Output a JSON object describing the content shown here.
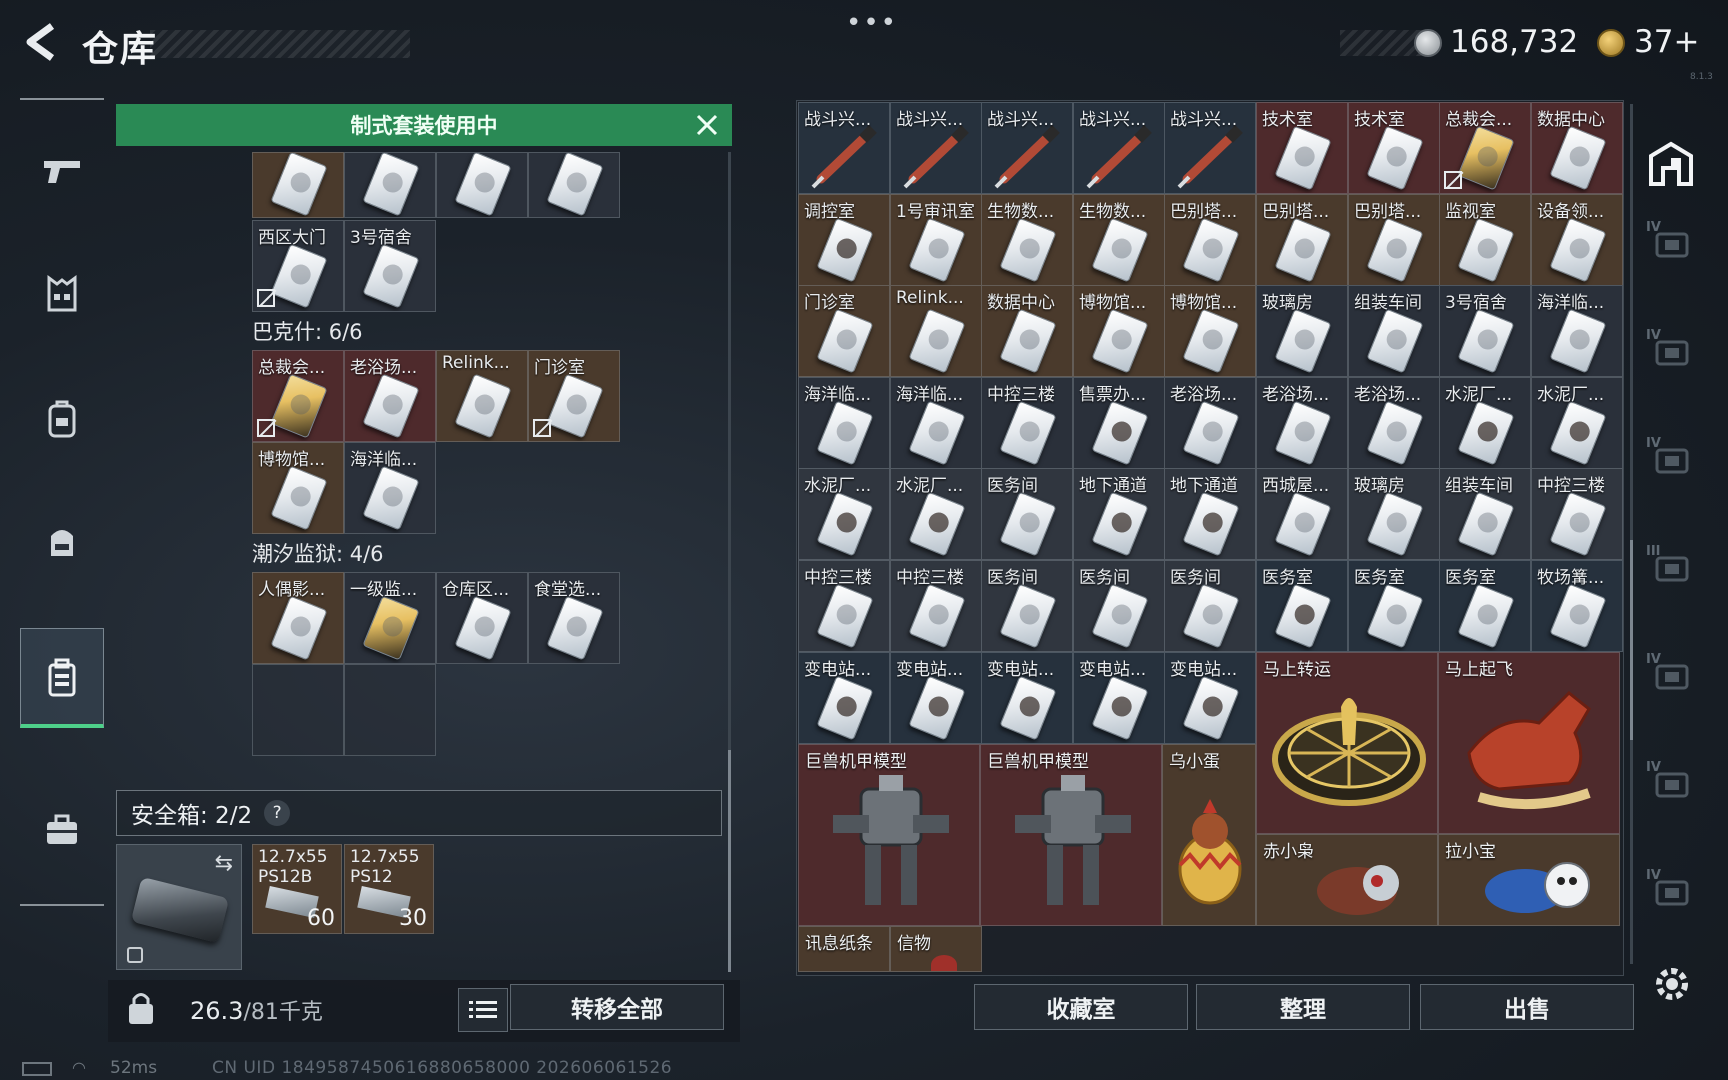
{
  "header": {
    "title": "仓库",
    "dots": "•••",
    "currency_silver": "168,732",
    "currency_gold": "37+",
    "corner_small": "8.1.3"
  },
  "left_nav": {
    "items": [
      "weapons",
      "armor",
      "backpack",
      "rig",
      "keycard-case",
      "briefcase"
    ],
    "active": "keycard-case"
  },
  "kit_banner": {
    "label": "制式套装使用中"
  },
  "left_panel": {
    "top_row_1": [
      {
        "label": "",
        "bg": "bg-brown",
        "card": "white"
      },
      {
        "label": "",
        "bg": "bg-dark",
        "card": "white"
      },
      {
        "label": "",
        "bg": "bg-dark",
        "card": "white"
      },
      {
        "label": "",
        "bg": "bg-dark",
        "card": "white"
      }
    ],
    "top_row_2": [
      {
        "label": "西区大门",
        "bg": "bg-dark",
        "card": "white",
        "locked": true
      },
      {
        "label": "3号宿舍",
        "bg": "bg-dark",
        "card": "white"
      }
    ],
    "section1_title": "巴克什: 6/6",
    "section1_row1": [
      {
        "label": "总裁会...",
        "bg": "bg-red",
        "card": "gold",
        "locked": true
      },
      {
        "label": "老浴场...",
        "bg": "bg-red",
        "card": "white"
      },
      {
        "label": "Relink...",
        "bg": "bg-brown",
        "card": "white"
      },
      {
        "label": "门诊室",
        "bg": "bg-brown",
        "card": "white",
        "locked": true
      }
    ],
    "section1_row2": [
      {
        "label": "博物馆...",
        "bg": "bg-brown",
        "card": "white"
      },
      {
        "label": "海洋临...",
        "bg": "bg-dark",
        "card": "white"
      }
    ],
    "section2_title": "潮汐监狱: 4/6",
    "section2_row1": [
      {
        "label": "人偶影...",
        "bg": "bg-brown",
        "card": "white"
      },
      {
        "label": "一级监...",
        "bg": "bg-dark",
        "card": "gold"
      },
      {
        "label": "仓库区...",
        "bg": "bg-dark",
        "card": "white"
      },
      {
        "label": "食堂选...",
        "bg": "bg-dark",
        "card": "white"
      }
    ]
  },
  "safe_box": {
    "label": "安全箱: 2/2",
    "help": "?",
    "swap_icon": "⇆",
    "ammo": [
      {
        "label": "12.7x55 PS12B",
        "qty": "60"
      },
      {
        "label": "12.7x55 PS12",
        "qty": "30"
      }
    ]
  },
  "footer_left": {
    "weight": "26.3",
    "weight_max": "/81千克",
    "transfer_all": "转移全部"
  },
  "grid": {
    "rows": [
      [
        {
          "label": "战斗兴...",
          "bg": "bg-blue",
          "item": "stim"
        },
        {
          "label": "战斗兴...",
          "bg": "bg-blue",
          "item": "stim"
        },
        {
          "label": "战斗兴...",
          "bg": "bg-blue",
          "item": "stim"
        },
        {
          "label": "战斗兴...",
          "bg": "bg-blue",
          "item": "stim"
        },
        {
          "label": "战斗兴...",
          "bg": "bg-blue",
          "item": "stim"
        },
        {
          "label": "技术室",
          "bg": "bg-red",
          "item": "card"
        },
        {
          "label": "技术室",
          "bg": "bg-red",
          "item": "card"
        },
        {
          "label": "总裁会...",
          "bg": "bg-red",
          "item": "card-gold",
          "locked": true
        },
        {
          "label": "数据中心",
          "bg": "bg-red",
          "item": "card"
        }
      ],
      [
        {
          "label": "调控室",
          "bg": "bg-brown",
          "item": "card-dark"
        },
        {
          "label": "1号审讯室",
          "bg": "bg-brown",
          "item": "card"
        },
        {
          "label": "生物数...",
          "bg": "bg-brown",
          "item": "card"
        },
        {
          "label": "生物数...",
          "bg": "bg-brown",
          "item": "card"
        },
        {
          "label": "巴别塔...",
          "bg": "bg-brown",
          "item": "card"
        },
        {
          "label": "巴别塔...",
          "bg": "bg-brown",
          "item": "card"
        },
        {
          "label": "巴别塔...",
          "bg": "bg-brown",
          "item": "card"
        },
        {
          "label": "监视室",
          "bg": "bg-brown",
          "item": "card"
        },
        {
          "label": "设备领...",
          "bg": "bg-brown",
          "item": "card"
        }
      ],
      [
        {
          "label": "门诊室",
          "bg": "bg-brown",
          "item": "card"
        },
        {
          "label": "Relink...",
          "bg": "bg-brown",
          "item": "card"
        },
        {
          "label": "数据中心",
          "bg": "bg-brown",
          "item": "card"
        },
        {
          "label": "博物馆...",
          "bg": "bg-brown",
          "item": "card"
        },
        {
          "label": "博物馆...",
          "bg": "bg-brown",
          "item": "card"
        },
        {
          "label": "玻璃房",
          "bg": "bg-dark",
          "item": "card"
        },
        {
          "label": "组装车间",
          "bg": "bg-dark",
          "item": "card"
        },
        {
          "label": "3号宿舍",
          "bg": "bg-dark",
          "item": "card"
        },
        {
          "label": "海洋临...",
          "bg": "bg-dark",
          "item": "card"
        }
      ],
      [
        {
          "label": "海洋临...",
          "bg": "bg-dark",
          "item": "card"
        },
        {
          "label": "海洋临...",
          "bg": "bg-dark",
          "item": "card"
        },
        {
          "label": "中控三楼",
          "bg": "bg-dark",
          "item": "card"
        },
        {
          "label": "售票办...",
          "bg": "bg-dark",
          "item": "card-dark"
        },
        {
          "label": "老浴场...",
          "bg": "bg-dark",
          "item": "card"
        },
        {
          "label": "老浴场...",
          "bg": "bg-dark",
          "item": "card"
        },
        {
          "label": "老浴场...",
          "bg": "bg-dark",
          "item": "card"
        },
        {
          "label": "水泥厂...",
          "bg": "bg-dark",
          "item": "card-dark"
        },
        {
          "label": "水泥厂...",
          "bg": "bg-dark",
          "item": "card-dark"
        }
      ],
      [
        {
          "label": "水泥厂...",
          "bg": "bg-slate",
          "item": "card-dark"
        },
        {
          "label": "水泥厂...",
          "bg": "bg-slate",
          "item": "card-dark"
        },
        {
          "label": "医务间",
          "bg": "bg-slate",
          "item": "card"
        },
        {
          "label": "地下通道",
          "bg": "bg-slate",
          "item": "card-dark"
        },
        {
          "label": "地下通道",
          "bg": "bg-slate",
          "item": "card-dark"
        },
        {
          "label": "西城屋...",
          "bg": "bg-slate",
          "item": "card"
        },
        {
          "label": "玻璃房",
          "bg": "bg-slate",
          "item": "card"
        },
        {
          "label": "组装车间",
          "bg": "bg-slate",
          "item": "card"
        },
        {
          "label": "中控三楼",
          "bg": "bg-slate",
          "item": "card"
        }
      ],
      [
        {
          "label": "中控三楼",
          "bg": "bg-slate",
          "item": "card"
        },
        {
          "label": "中控三楼",
          "bg": "bg-slate",
          "item": "card"
        },
        {
          "label": "医务间",
          "bg": "bg-slate",
          "item": "card"
        },
        {
          "label": "医务间",
          "bg": "bg-slate",
          "item": "card"
        },
        {
          "label": "医务间",
          "bg": "bg-slate",
          "item": "card"
        },
        {
          "label": "医务室",
          "bg": "bg-blue",
          "item": "card-dark"
        },
        {
          "label": "医务室",
          "bg": "bg-blue",
          "item": "card"
        },
        {
          "label": "医务室",
          "bg": "bg-blue",
          "item": "card"
        },
        {
          "label": "牧场篝...",
          "bg": "bg-blue",
          "item": "card"
        }
      ],
      [
        {
          "label": "变电站...",
          "bg": "bg-blue",
          "item": "card-dark"
        },
        {
          "label": "变电站...",
          "bg": "bg-blue",
          "item": "card-dark"
        },
        {
          "label": "变电站...",
          "bg": "bg-blue",
          "item": "card-dark"
        },
        {
          "label": "变电站...",
          "bg": "bg-blue",
          "item": "card-dark"
        },
        {
          "label": "变电站...",
          "bg": "bg-blue",
          "item": "card-dark"
        }
      ]
    ],
    "big_items": {
      "horse_wheel": "马上转运",
      "horse_fly": "马上起飞",
      "mech1": "巨兽机甲模型",
      "mech2": "巨兽机甲模型",
      "egg": "乌小蛋",
      "owl": "赤小枭",
      "pull": "拉小宝",
      "note": "讯息纸条",
      "letter": "信物"
    }
  },
  "right_nav": {
    "tiers": [
      "IV",
      "IV",
      "IV",
      "III",
      "IV",
      "IV",
      "IV"
    ]
  },
  "footer_right": {
    "collection": "收藏室",
    "sort": "整理",
    "sell": "出售"
  },
  "status": {
    "ping": "52ms",
    "uid": "CN UID 1849587450616880658000 202606061526"
  },
  "colors": {
    "accent_green": "#2a8a55",
    "active_nav_underline": "#4ed08a"
  }
}
